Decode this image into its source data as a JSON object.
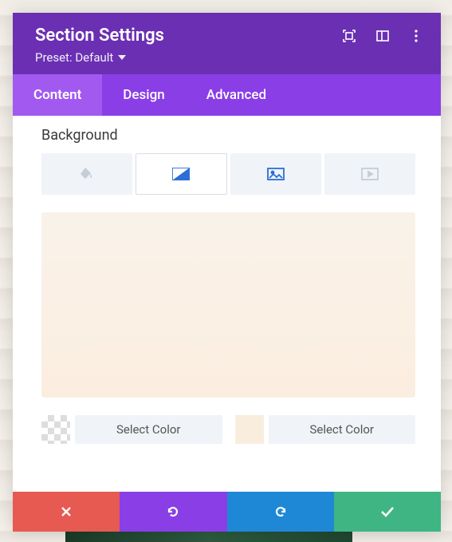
{
  "header": {
    "title": "Section Settings",
    "preset_label": "Preset: Default"
  },
  "tabs": {
    "content": "Content",
    "design": "Design",
    "advanced": "Advanced"
  },
  "content": {
    "background_label": "Background",
    "select_color_1": "Select Color",
    "select_color_2": "Select Color"
  },
  "colors": {
    "gradient_top": "#f9f2e9",
    "gradient_bottom": "#fbeee0",
    "swatch2": "#f9eede"
  }
}
